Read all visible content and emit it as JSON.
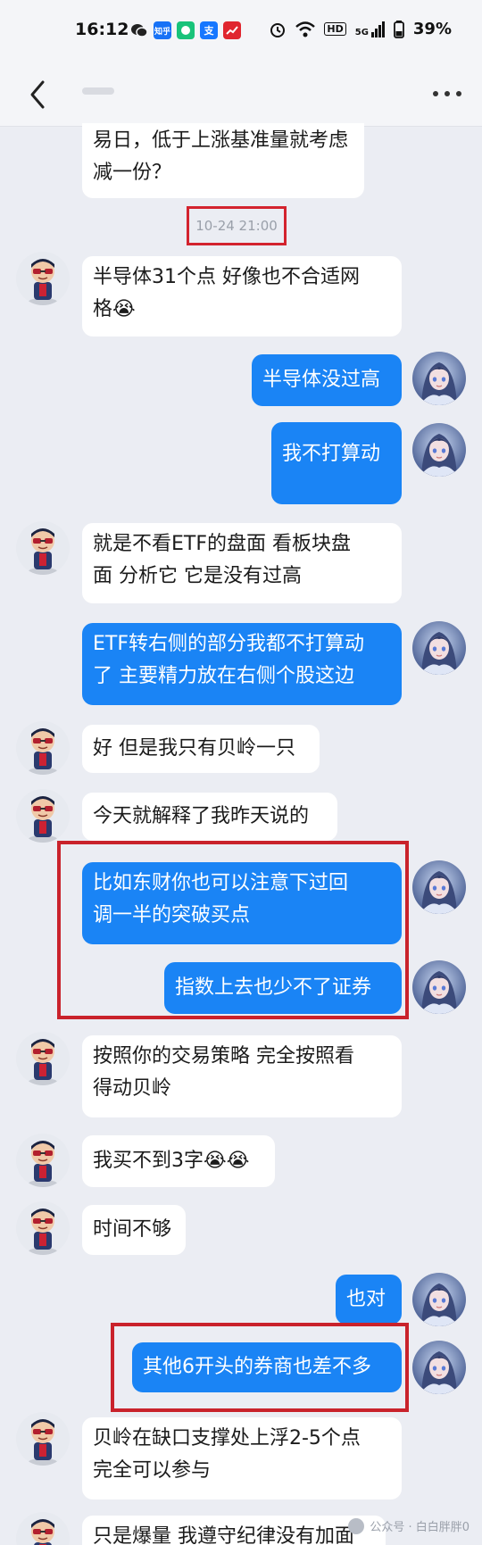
{
  "status_bar": {
    "time": "16:12",
    "apps": [
      {
        "icon": "wechat-icon",
        "label": "",
        "color": "#1b1b1b"
      },
      {
        "icon": "zhihu-icon",
        "label": "知乎",
        "color": "#1772f6"
      },
      {
        "icon": "chat-app-icon",
        "label": "",
        "color": "#18c37a"
      },
      {
        "icon": "alipay-icon",
        "label": "支",
        "color": "#1677ff"
      },
      {
        "icon": "stocks-app-icon",
        "label": "",
        "color": "#e0262f"
      }
    ],
    "indicators": [
      "alarm-icon",
      "wifi-icon",
      "hd-icon",
      "signal-5g-icon",
      "battery-icon"
    ],
    "hd_label": "HD",
    "network_label": "5G",
    "battery": "39%"
  },
  "header": {
    "back_icon": "chevron-left-icon",
    "more_icon": "more-dots-icon"
  },
  "timestamp": "10-24 21:00",
  "messages": [
    {
      "side": "in",
      "text": "易日，低于上涨基准量就考虑减一份？",
      "line1": "易日，低于上涨基准量就考虑",
      "line2": "减一份？"
    },
    {
      "side": "in",
      "line1": "半导体31个点 好像也不合适网",
      "line2": "格😭"
    },
    {
      "side": "out",
      "line1": "半导体没过高"
    },
    {
      "side": "out",
      "line1": "我不打算动"
    },
    {
      "side": "in",
      "line1": "就是不看ETF的盘面 看板块盘",
      "line2": "面 分析它 它是没有过高"
    },
    {
      "side": "out",
      "line1": "ETF转右侧的部分我都不打算动",
      "line2": "了 主要精力放在右侧个股这边"
    },
    {
      "side": "in",
      "line1": "好 但是我只有贝岭一只"
    },
    {
      "side": "in",
      "line1": "今天就解释了我昨天说的"
    },
    {
      "side": "out",
      "line1": "比如东财你也可以注意下过回",
      "line2": "调一半的突破买点"
    },
    {
      "side": "out",
      "line1": "指数上去也少不了证券"
    },
    {
      "side": "in",
      "line1": "按照你的交易策略 完全按照看",
      "line2": "得动贝岭"
    },
    {
      "side": "in",
      "line1": "我买不到3字😭😭"
    },
    {
      "side": "in",
      "line1": "时间不够"
    },
    {
      "side": "out",
      "line1": "也对"
    },
    {
      "side": "out",
      "line1": "其他6开头的券商也差不多"
    },
    {
      "side": "in",
      "line1": "贝岭在缺口支撑处上浮2-5个点",
      "line2": "完全可以参与"
    },
    {
      "side": "in",
      "line1": "只是爆量 我遵守纪律没有加面"
    }
  ],
  "watermark": "公众号 · 白白胖胖0",
  "colors": {
    "background": "#ebedf3",
    "bubble_out": "#1a84f5",
    "bubble_in": "#ffffff",
    "highlight": "#c9222b"
  }
}
